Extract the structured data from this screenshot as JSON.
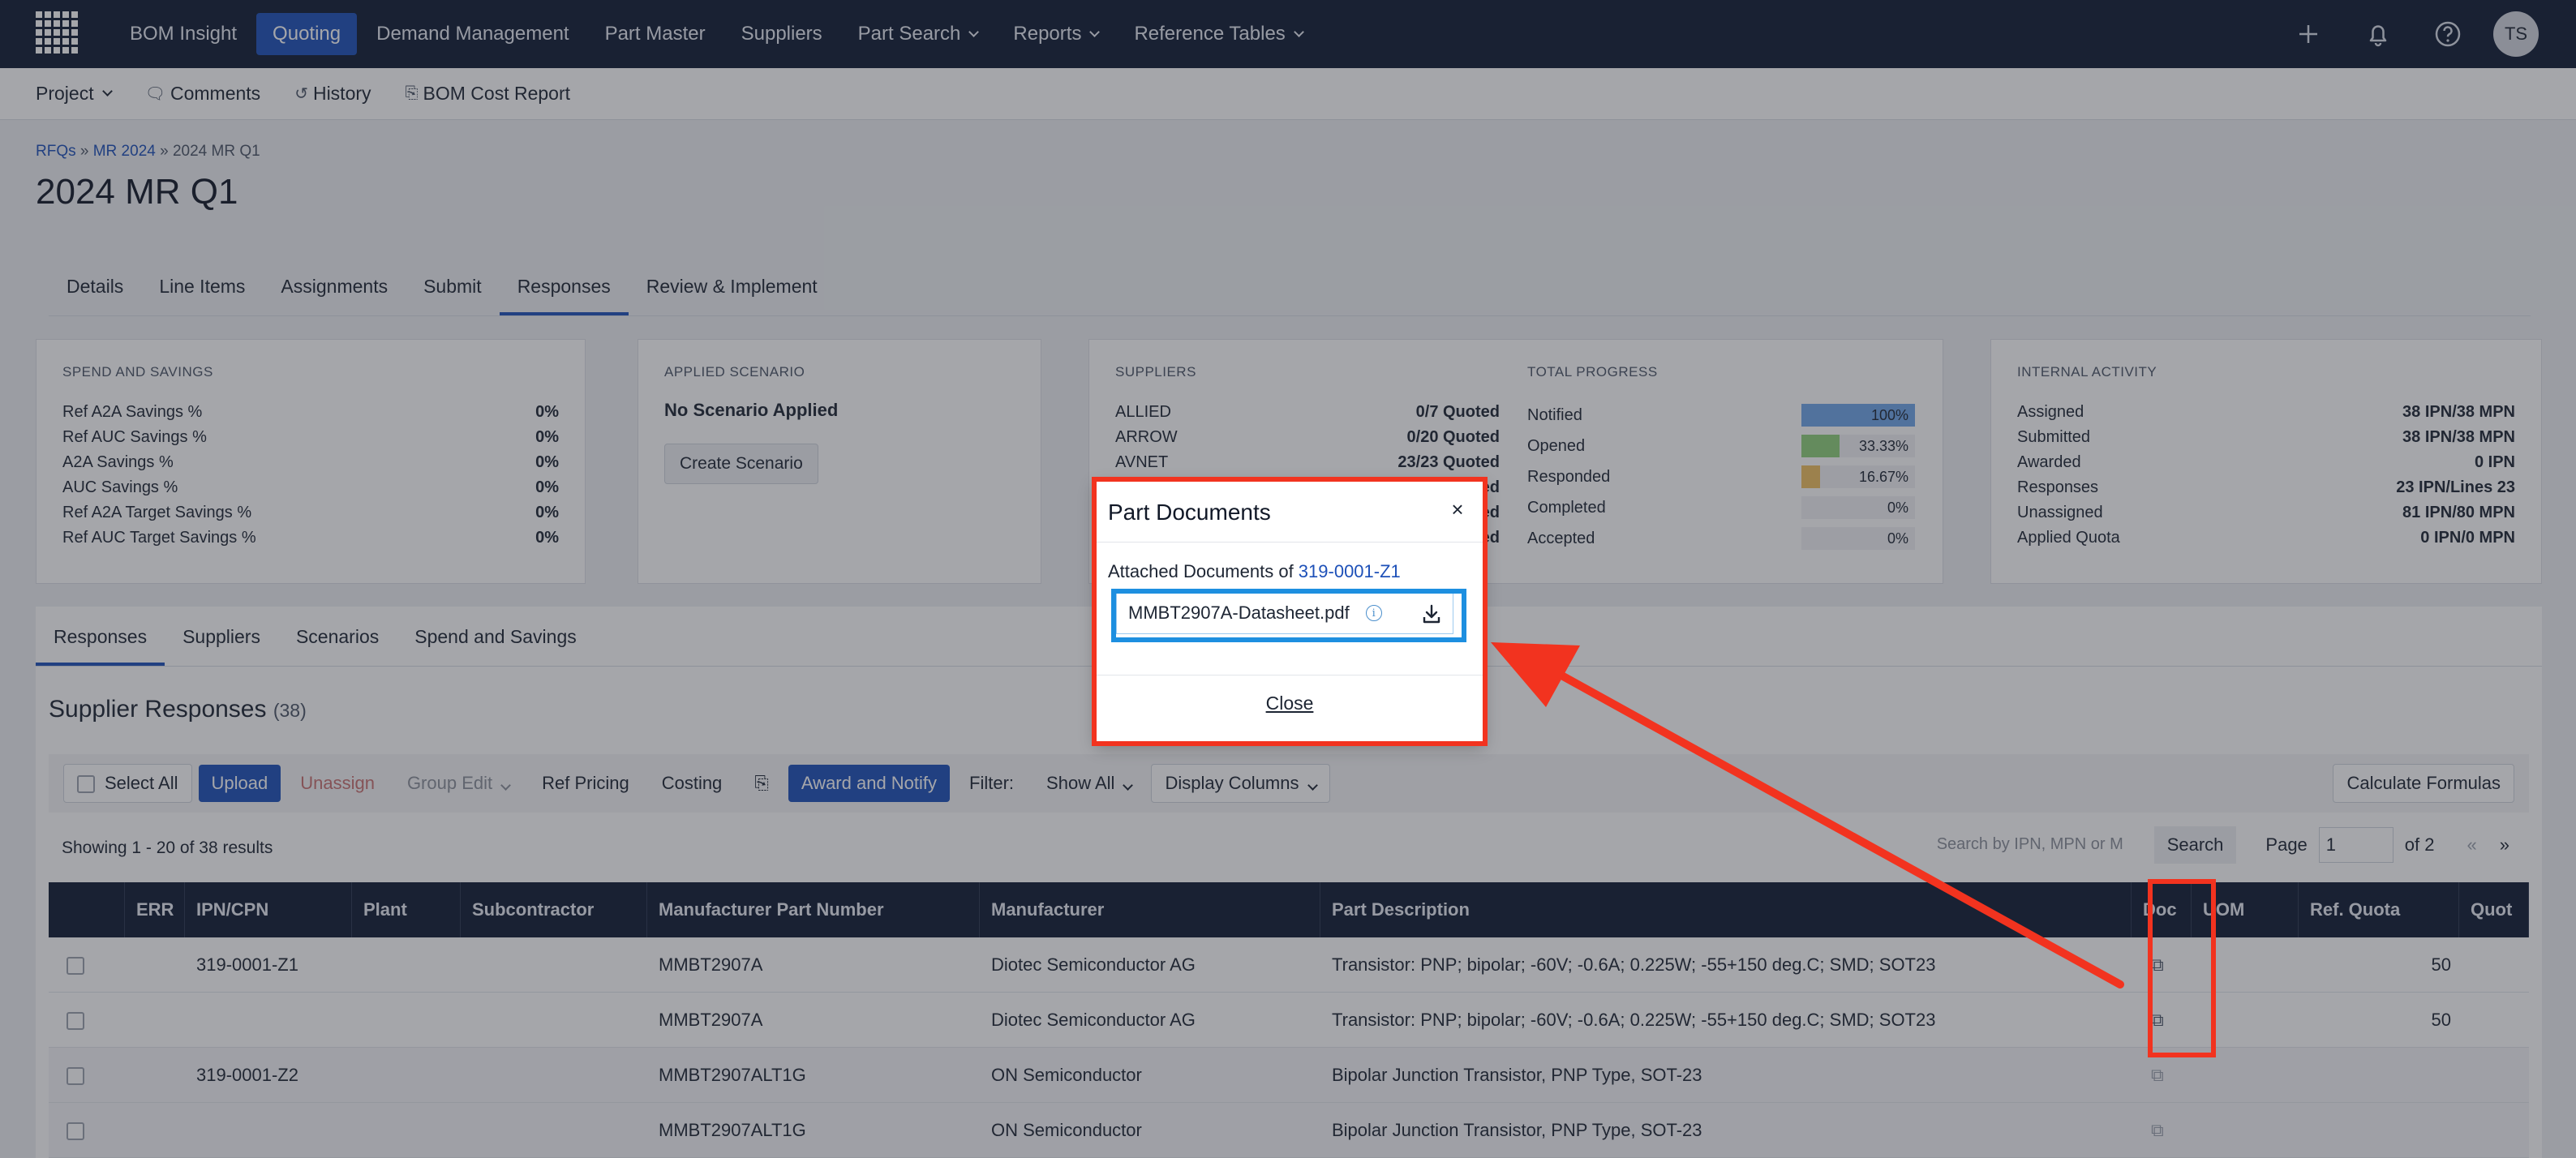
{
  "topnav": {
    "items": [
      "BOM Insight",
      "Quoting",
      "Demand Management",
      "Part Master",
      "Suppliers",
      "Part Search",
      "Reports",
      "Reference Tables"
    ],
    "active_index": 1,
    "avatar_initials": "TS"
  },
  "subbar": {
    "project": "Project",
    "comments": "Comments",
    "history": "History",
    "bom_cost_report": "BOM Cost Report"
  },
  "breadcrumb": {
    "rfqs": "RFQs",
    "sep1": " » ",
    "mr2024": "MR 2024",
    "sep2": " » ",
    "current": "2024 MR Q1"
  },
  "page_title": "2024 MR Q1",
  "tabs": [
    "Details",
    "Line Items",
    "Assignments",
    "Submit",
    "Responses",
    "Review & Implement"
  ],
  "cards": {
    "spend": {
      "title": "SPEND AND SAVINGS",
      "rows": [
        [
          "Ref A2A Savings %",
          "0%"
        ],
        [
          "Ref AUC Savings %",
          "0%"
        ],
        [
          "A2A Savings %",
          "0%"
        ],
        [
          "AUC Savings %",
          "0%"
        ],
        [
          "Ref A2A Target Savings %",
          "0%"
        ],
        [
          "Ref AUC Target Savings %",
          "0%"
        ]
      ]
    },
    "scenario": {
      "title": "APPLIED SCENARIO",
      "status": "No Scenario Applied",
      "button": "Create Scenario"
    },
    "suppliers": {
      "title": "SUPPLIERS",
      "rows": [
        [
          "ALLIED",
          "0/7 Quoted"
        ],
        [
          "ARROW",
          "0/20 Quoted"
        ],
        [
          "AVNET",
          "23/23 Quoted"
        ],
        [
          "",
          "ed"
        ],
        [
          "",
          "ed"
        ],
        [
          "",
          "ed"
        ]
      ]
    },
    "progress": {
      "title": "TOTAL PROGRESS",
      "rows": [
        {
          "label": "Notified",
          "value": "100%",
          "pct": 100,
          "color": "#6ea6e8"
        },
        {
          "label": "Opened",
          "value": "33.33%",
          "pct": 33.33,
          "color": "#8fd07a"
        },
        {
          "label": "Responded",
          "value": "16.67%",
          "pct": 16.67,
          "color": "#f0c060"
        },
        {
          "label": "Completed",
          "value": "0%",
          "pct": 0,
          "color": "#f0a080"
        },
        {
          "label": "Accepted",
          "value": "0%",
          "pct": 0,
          "color": "#f090c0"
        }
      ]
    },
    "internal": {
      "title": "INTERNAL ACTIVITY",
      "rows": [
        [
          "Assigned",
          "38 IPN/38 MPN"
        ],
        [
          "Submitted",
          "38 IPN/38 MPN"
        ],
        [
          "Awarded",
          "0 IPN"
        ],
        [
          "Responses",
          "23 IPN/Lines 23"
        ],
        [
          "Unassigned",
          "81 IPN/80 MPN"
        ],
        [
          "Applied Quota",
          "0 IPN/0 MPN"
        ]
      ]
    }
  },
  "lower_tabs": [
    "Responses",
    "Suppliers",
    "Scenarios",
    "Spend and Savings"
  ],
  "supplier_responses": {
    "title": "Supplier Responses",
    "count": "(38)"
  },
  "toolbar": {
    "select_all": "Select All",
    "upload": "Upload",
    "unassign": "Unassign",
    "group_edit": "Group Edit",
    "ref_pricing": "Ref Pricing",
    "costing": "Costing",
    "award_notify": "Award and Notify",
    "filter_label": "Filter:",
    "filter_value": "Show All",
    "display_columns": "Display Columns",
    "calculate": "Calculate Formulas"
  },
  "results": {
    "showing": "Showing 1 - 20 of 38 results",
    "search_placeholder": "Search by IPN, MPN or M",
    "search_button": "Search",
    "page_label": "Page",
    "page_value": "1",
    "page_total": "of 2",
    "prev": "«",
    "next": "»"
  },
  "grid": {
    "headers": [
      "ERR",
      "IPN/CPN",
      "Plant",
      "Subcontractor",
      "Manufacturer Part Number",
      "Manufacturer",
      "Part Description",
      "Doc",
      "UOM",
      "Ref. Quota",
      "Quot"
    ],
    "rows": [
      {
        "ipn": "319-0001-Z1",
        "mpn": "MMBT2907A",
        "mfr": "Diotec Semiconductor AG",
        "desc": "Transistor: PNP; bipolar; -60V; -0.6A; 0.225W; -55+150 deg.C; SMD; SOT23",
        "quota": "50"
      },
      {
        "ipn": "",
        "mpn": "MMBT2907A",
        "mfr": "Diotec Semiconductor AG",
        "desc": "Transistor: PNP; bipolar; -60V; -0.6A; 0.225W; -55+150 deg.C; SMD; SOT23",
        "quota": "50"
      },
      {
        "ipn": "319-0001-Z2",
        "mpn": "MMBT2907ALT1G",
        "mfr": "ON Semiconductor",
        "desc": "Bipolar Junction Transistor, PNP Type, SOT-23",
        "quota": ""
      },
      {
        "ipn": "",
        "mpn": "MMBT2907ALT1G",
        "mfr": "ON Semiconductor",
        "desc": "Bipolar Junction Transistor, PNP Type, SOT-23",
        "quota": ""
      }
    ]
  },
  "modal": {
    "title": "Part Documents",
    "close_x": "×",
    "attached_prefix": "Attached Documents of ",
    "part_link": "319-0001-Z1",
    "file_name": "MMBT2907A-Datasheet.pdf",
    "close_button": "Close"
  },
  "annotation_colors": {
    "highlight_red": "#f2331f",
    "highlight_blue": "#1d8fe0"
  }
}
